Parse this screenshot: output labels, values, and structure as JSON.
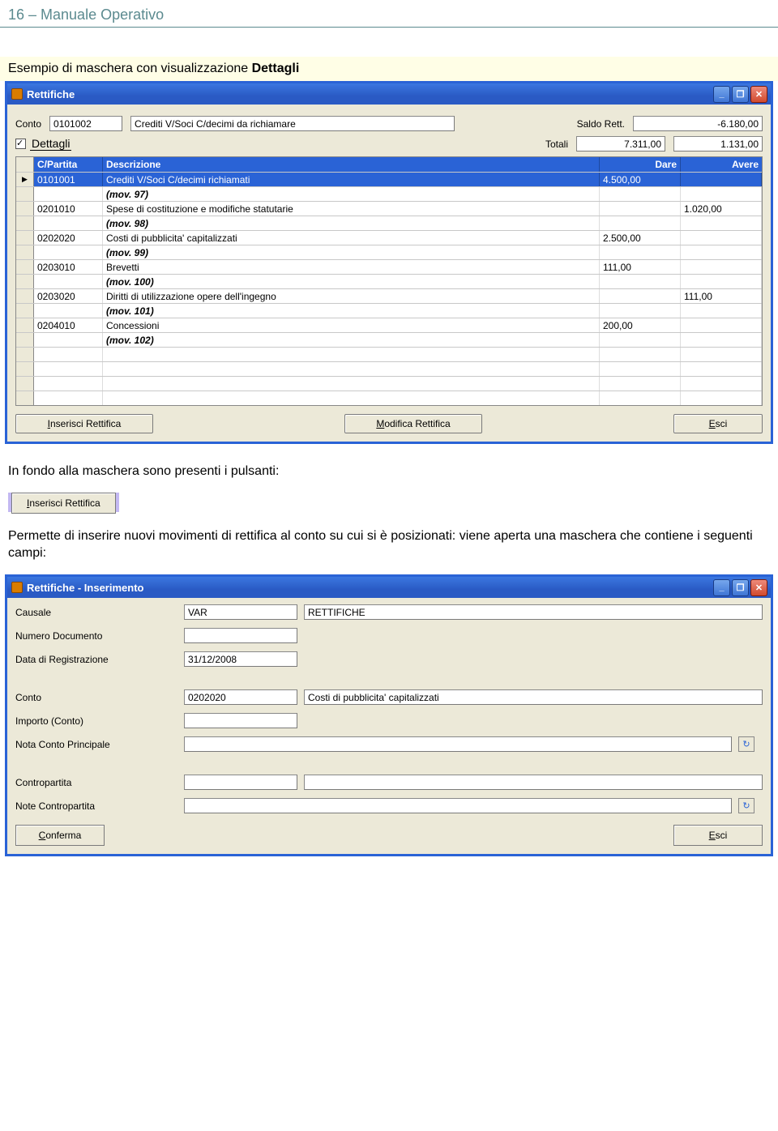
{
  "page_header": "16 – Manuale Operativo",
  "caption": {
    "prefix": "Esempio di maschera con visualizzazione ",
    "bold": "Dettagli"
  },
  "window1": {
    "title": "Rettifiche",
    "controls": {
      "min": "_",
      "max": "❐",
      "close": "✕"
    },
    "conto_label": "Conto",
    "conto_code": "0101002",
    "conto_desc": "Crediti V/Soci C/decimi da richiamare",
    "saldo_label": "Saldo Rett.",
    "saldo_value": "-6.180,00",
    "dettagli_label": "Dettagli",
    "totali_label": "Totali",
    "tot_dare": "7.311,00",
    "tot_avere": "1.131,00",
    "headers": {
      "cpartita": "C/Partita",
      "descr": "Descrizione",
      "dare": "Dare",
      "avere": "Avere"
    },
    "rows": [
      {
        "marker": true,
        "selected": true,
        "c": "0101001",
        "d": "Crediti V/Soci C/decimi richiamati",
        "dare": "4.500,00",
        "avere": ""
      },
      {
        "mov": "(mov. 97)"
      },
      {
        "c": "0201010",
        "d": "Spese di costituzione e modifiche statutarie",
        "dare": "",
        "avere": "1.020,00"
      },
      {
        "mov": "(mov. 98)"
      },
      {
        "c": "0202020",
        "d": "Costi di pubblicita' capitalizzati",
        "dare": "2.500,00",
        "avere": ""
      },
      {
        "mov": "(mov. 99)"
      },
      {
        "c": "0203010",
        "d": "Brevetti",
        "dare": "111,00",
        "avere": ""
      },
      {
        "mov": "(mov. 100)"
      },
      {
        "c": "0203020",
        "d": "Diritti di utilizzazione opere dell'ingegno",
        "dare": "",
        "avere": "111,00"
      },
      {
        "mov": "(mov. 101)"
      },
      {
        "c": "0204010",
        "d": "Concessioni",
        "dare": "200,00",
        "avere": ""
      },
      {
        "mov": "(mov. 102)"
      },
      {
        "empty": true
      },
      {
        "empty": true
      },
      {
        "empty": true
      },
      {
        "empty": true
      }
    ],
    "buttons": {
      "insert": "Inserisci Rettifica",
      "modify": "Modifica Rettifica",
      "exit": "Esci"
    },
    "buttons_u": {
      "insert": "I",
      "modify": "M",
      "exit": "E"
    }
  },
  "text_after1": "In fondo alla maschera sono presenti i pulsanti:",
  "snippet_button": "Inserisci Rettifica",
  "snippet_button_u": "I",
  "text_after2": "Permette di inserire nuovi movimenti di rettifica al conto su cui si è posizionati: viene aperta una maschera che contiene i seguenti campi:",
  "window2": {
    "title": "Rettifiche - Inserimento",
    "controls": {
      "min": "_",
      "max": "❐",
      "close": "✕"
    },
    "labels": {
      "causale": "Causale",
      "numero_doc": "Numero Documento",
      "data_reg": "Data di Registrazione",
      "conto": "Conto",
      "importo": "Importo (Conto)",
      "nota_princ": "Nota Conto Principale",
      "contropartita": "Contropartita",
      "note_contro": "Note Contropartita"
    },
    "values": {
      "causale_code": "VAR",
      "causale_desc": "RETTIFICHE",
      "numero_doc": "",
      "data_reg": "31/12/2008",
      "conto_code": "0202020",
      "conto_desc": "Costi di pubblicita' capitalizzati",
      "importo": "",
      "nota_princ": "",
      "contropartita": "",
      "note_contro": ""
    },
    "buttons": {
      "confirm": "Conferma",
      "exit": "Esci"
    },
    "buttons_u": {
      "confirm": "C",
      "exit": "E"
    },
    "icon_glyph": "↻"
  }
}
